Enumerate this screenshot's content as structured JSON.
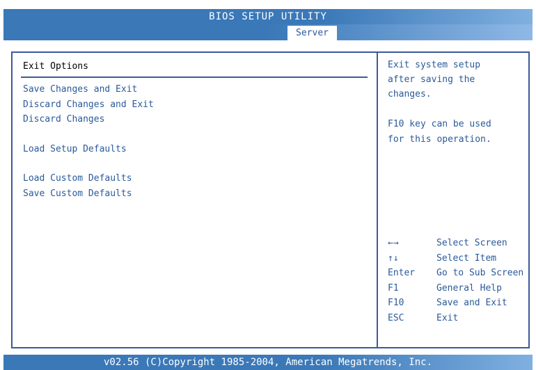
{
  "header": {
    "title": "BIOS SETUP UTILITY"
  },
  "tabs": {
    "active": "Server"
  },
  "exit_menu": {
    "title": "Exit Options",
    "items": [
      "Save Changes and Exit",
      "Discard Changes and Exit",
      "Discard Changes",
      "Load Setup Defaults",
      "Load Custom Defaults",
      "Save Custom Defaults"
    ]
  },
  "help": {
    "lines": [
      "Exit system setup",
      "after saving the",
      "changes.",
      "F10 key can be used",
      "for this operation."
    ]
  },
  "keys": [
    {
      "key": "←→",
      "desc": "Select Screen"
    },
    {
      "key": "↑↓",
      "desc": "Select Item"
    },
    {
      "key": "Enter",
      "desc": "Go to Sub Screen"
    },
    {
      "key": "F1",
      "desc": "General Help"
    },
    {
      "key": "F10",
      "desc": "Save and Exit"
    },
    {
      "key": "ESC",
      "desc": "Exit"
    }
  ],
  "footer": {
    "text": "v02.56 (C)Copyright 1985-2004, American Megatrends, Inc."
  },
  "colors": {
    "bar": "#3a78b8",
    "text": "#2a5a9a",
    "border": "#3a5a98"
  }
}
